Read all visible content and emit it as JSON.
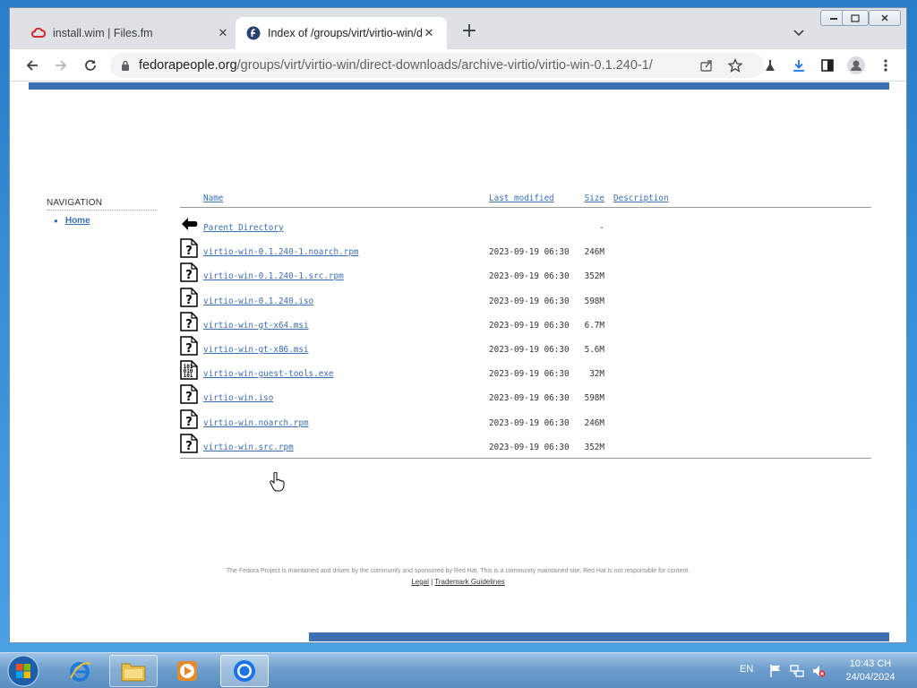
{
  "browser": {
    "tabs": [
      {
        "title": "install.wim | Files.fm",
        "active": false,
        "icon": "files-fm-cloud-icon"
      },
      {
        "title": "Index of /groups/virt/virtio-win/d",
        "active": true,
        "icon": "fedora-icon"
      }
    ],
    "url_host": "fedorapeople.org",
    "url_path": "/groups/virt/virtio-win/direct-downloads/archive-virtio/virtio-win-0.1.240-1/"
  },
  "page": {
    "nav_title": "NAVIGATION",
    "nav_items": [
      {
        "label": "Home"
      }
    ],
    "columns": {
      "name": "Name",
      "last_modified": "Last modified",
      "size": "Size",
      "description": "Description"
    },
    "parent": {
      "name": "Parent Directory",
      "size": "-"
    },
    "files": [
      {
        "name": "virtio-win-0.1.240-1.noarch.rpm",
        "modified": "2023-09-19 06:30",
        "size": "246M",
        "icon": "unknown-file-icon"
      },
      {
        "name": "virtio-win-0.1.240-1.src.rpm",
        "modified": "2023-09-19 06:30",
        "size": "352M",
        "icon": "unknown-file-icon"
      },
      {
        "name": "virtio-win-0.1.240.iso",
        "modified": "2023-09-19 06:30",
        "size": "598M",
        "icon": "unknown-file-icon"
      },
      {
        "name": "virtio-win-gt-x64.msi",
        "modified": "2023-09-19 06:30",
        "size": "6.7M",
        "icon": "unknown-file-icon"
      },
      {
        "name": "virtio-win-gt-x86.msi",
        "modified": "2023-09-19 06:30",
        "size": "5.6M",
        "icon": "unknown-file-icon"
      },
      {
        "name": "virtio-win-guest-tools.exe",
        "modified": "2023-09-19 06:30",
        "size": "32M",
        "icon": "binary-file-icon"
      },
      {
        "name": "virtio-win.iso",
        "modified": "2023-09-19 06:30",
        "size": "598M",
        "icon": "unknown-file-icon"
      },
      {
        "name": "virtio-win.noarch.rpm",
        "modified": "2023-09-19 06:30",
        "size": "246M",
        "icon": "unknown-file-icon"
      },
      {
        "name": "virtio-win.src.rpm",
        "modified": "2023-09-19 06:30",
        "size": "352M",
        "icon": "unknown-file-icon"
      }
    ],
    "footer_text": "The Fedora Project is maintained and driven by the community and sponsored by Red Hat. This is a community maintained site. Red Hat is not responsible for content.",
    "footer_links": [
      "Legal",
      "Trademark Guidelines"
    ],
    "footer_separator": "|"
  },
  "taskbar": {
    "apps": [
      "internet-explorer-icon",
      "file-explorer-icon",
      "media-player-icon",
      "chrome-icon"
    ],
    "language": "EN",
    "time": "10:43 CH",
    "date": "24/04/2024"
  },
  "colors": {
    "accent": "#3c6eb4",
    "link": "#3c6eb4"
  }
}
